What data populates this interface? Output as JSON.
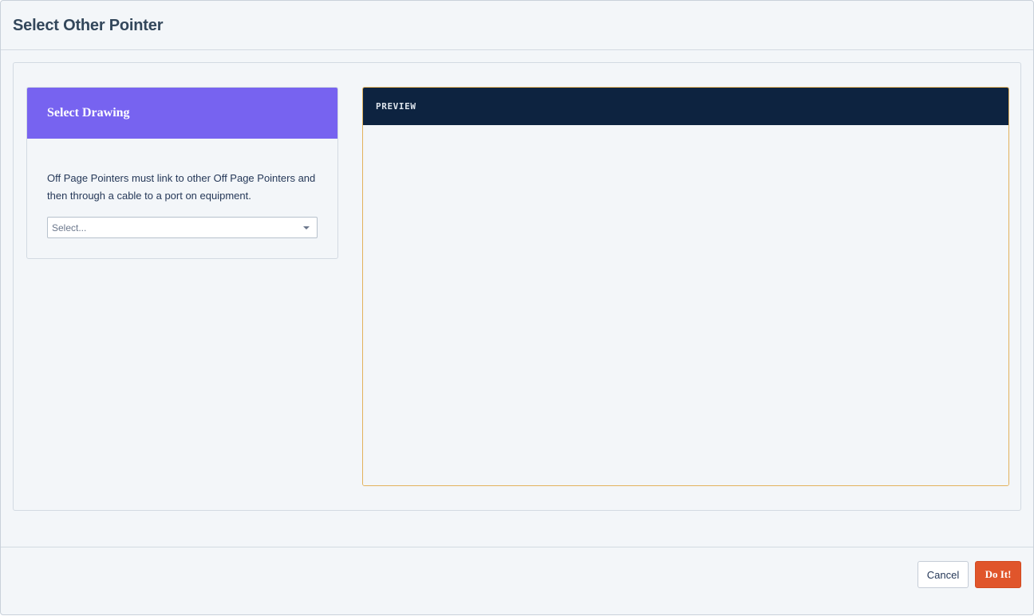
{
  "dialog": {
    "title": "Select Other Pointer"
  },
  "select_drawing": {
    "title": "Select Drawing",
    "description": "Off Page Pointers must link to other Off Page Pointers and then through a cable to a port on equipment.",
    "select": {
      "placeholder": "Select..."
    }
  },
  "preview": {
    "title": "PREVIEW"
  },
  "footer": {
    "cancel_label": "Cancel",
    "submit_label": "Do It!"
  },
  "colors": {
    "card_header": "#7763f0",
    "preview_header": "#0d2340",
    "preview_border": "#e2b25c",
    "submit_button": "#e0552b"
  },
  "icons": {
    "select_caret": "caret-down-icon"
  }
}
